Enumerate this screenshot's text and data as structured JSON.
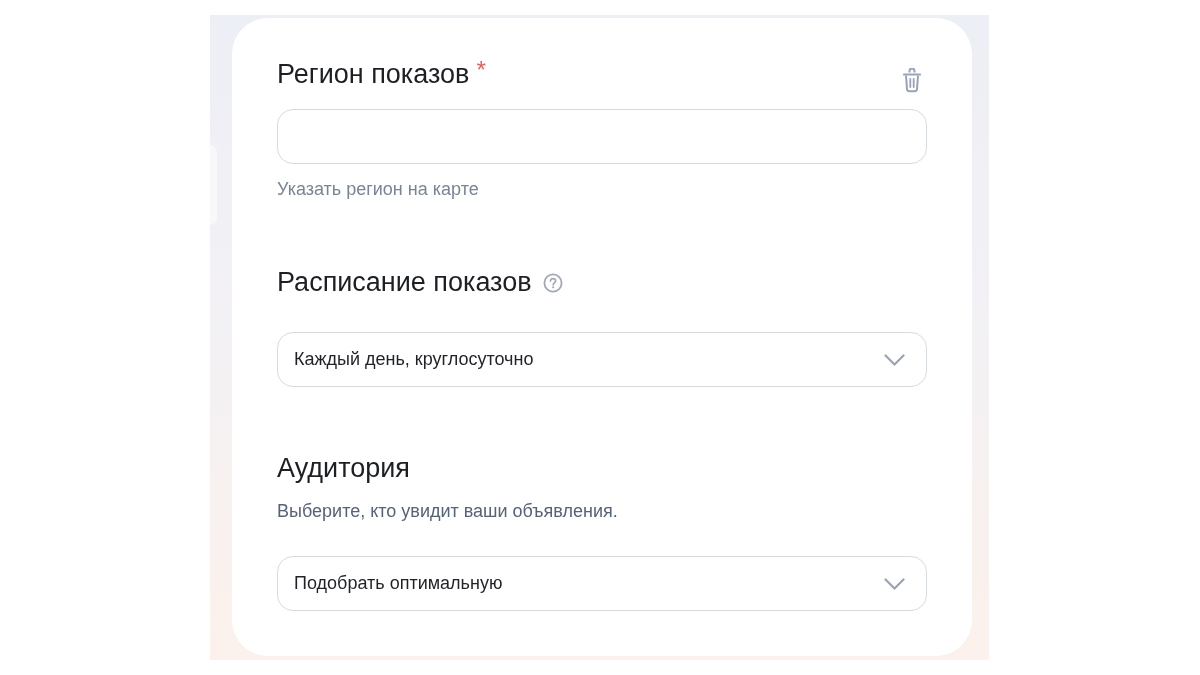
{
  "sections": [
    {
      "kind": "text-input",
      "title": "Регион показов",
      "required_mark": "*",
      "help": false,
      "removable": true,
      "link": "Указать регион на карте"
    },
    {
      "kind": "select",
      "title": "Расписание показов",
      "help": true,
      "removable": false,
      "value": "Каждый день, круглосуточно"
    },
    {
      "kind": "select",
      "title": "Аудитория",
      "help": false,
      "removable": false,
      "description": "Выберите, кто увидит ваши объявления.",
      "value": "Подобрать оптимальную"
    }
  ]
}
